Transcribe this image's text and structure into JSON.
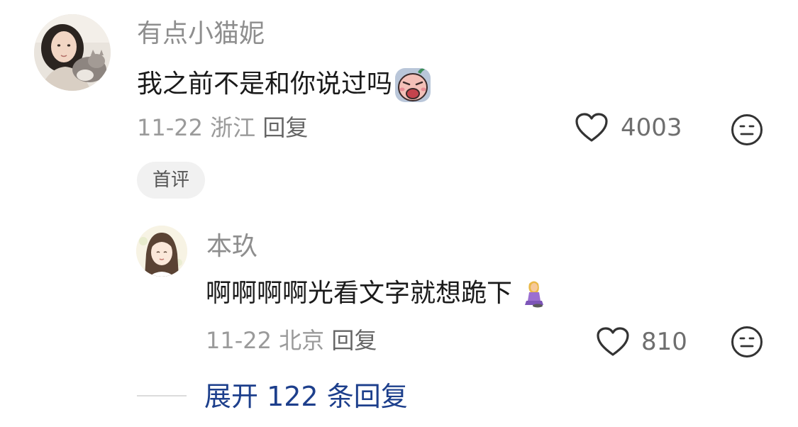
{
  "comments": [
    {
      "username": "有点小猫妮",
      "text": "我之前不是和你说过吗",
      "date": "11-22",
      "location": "浙江",
      "reply_label": "回复",
      "likes": "4003",
      "badge": "首评",
      "emoji_icon": "crying-face-sticker-icon"
    }
  ],
  "replies": [
    {
      "username": "本玖",
      "text": "啊啊啊啊光看文字就想跪下",
      "date": "11-22",
      "location": "北京",
      "reply_label": "回复",
      "likes": "810",
      "emoji_icon": "kneeling-woman-emoji-icon"
    }
  ],
  "expand_replies_label": "展开 122 条回复",
  "colors": {
    "link": "#1d3f8c",
    "meta": "#9a9a9a",
    "username": "#8e8e8e"
  }
}
